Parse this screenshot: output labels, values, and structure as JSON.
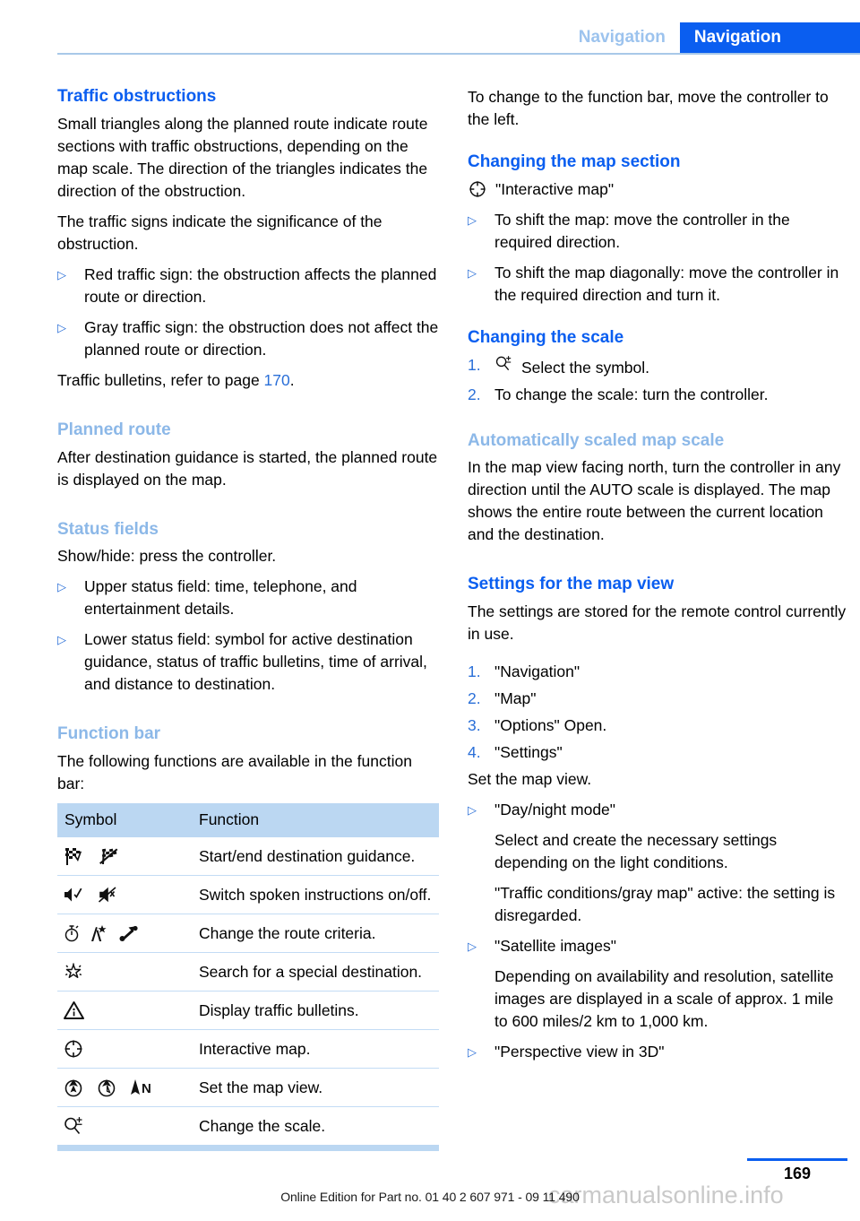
{
  "header": {
    "tab_inactive": "Navigation",
    "tab_active": "Navigation",
    "accent_blue": "#0a5ef0",
    "light_blue": "#8cb8e8"
  },
  "left_column": {
    "s1": {
      "heading": "Traffic obstructions",
      "p1": "Small triangles along the planned route indicate route sections with traffic obstructions, depending on the map scale. The direction of the triangles indicates the direction of the obstruction.",
      "p2": "The traffic signs indicate the significance of the obstruction.",
      "b1": "Red traffic sign: the obstruction affects the planned route or direction.",
      "b2": "Gray traffic sign: the obstruction does not affect the planned route or direction.",
      "p3_pre": "Traffic bulletins, refer to page ",
      "p3_link": "170",
      "p3_post": "."
    },
    "s2": {
      "heading": "Planned route",
      "p1": "After destination guidance is started, the planned route is displayed on the map."
    },
    "s3": {
      "heading": "Status fields",
      "p1": "Show/hide: press the controller.",
      "b1": "Upper status field: time, telephone, and entertainment details.",
      "b2": "Lower status field: symbol for active destination guidance, status of traffic bulletins, time of arrival, and distance to destination."
    },
    "s4": {
      "heading": "Function bar",
      "p1": "The following functions are available in the function bar:"
    },
    "table": {
      "headers": [
        "Symbol",
        "Function"
      ],
      "rows": [
        {
          "icons": [
            "checkered-flag-icon",
            "checkered-flag-crossed-icon"
          ],
          "function": "Start/end destination guidance."
        },
        {
          "icons": [
            "speaker-check-icon",
            "speaker-mute-icon"
          ],
          "function": "Switch spoken instructions on/off."
        },
        {
          "icons": [
            "stopwatch-icon",
            "road-star-icon",
            "route-arrow-icon"
          ],
          "function": "Change the route criteria."
        },
        {
          "icons": [
            "star-burst-icon"
          ],
          "function": "Search for a special destination."
        },
        {
          "icons": [
            "warning-triangle-info-icon"
          ],
          "function": "Display traffic bulletins."
        },
        {
          "icons": [
            "interactive-map-icon"
          ],
          "function": "Interactive map."
        },
        {
          "icons": [
            "map-view-circle-icon",
            "map-view-circle-outline-icon",
            "north-arrow-icon"
          ],
          "function": "Set the map view."
        },
        {
          "icons": [
            "magnifier-plusminus-icon"
          ],
          "function": "Change the scale."
        }
      ]
    }
  },
  "right_column": {
    "intro": "To change to the function bar, move the controller to the left.",
    "s1": {
      "heading": "Changing the map section",
      "sym_label": "\"Interactive map\"",
      "b1": "To shift the map: move the controller in the required direction.",
      "b2": "To shift the map diagonally: move the controller in the required direction and turn it."
    },
    "s2": {
      "heading": "Changing the scale",
      "n1_num": "1.",
      "n1": "Select the symbol.",
      "n2_num": "2.",
      "n2": "To change the scale: turn the controller."
    },
    "s3": {
      "heading": "Automatically scaled map scale",
      "p1": "In the map view facing north, turn the controller in any direction until the AUTO scale is displayed. The map shows the entire route between the current location and the destination."
    },
    "s4": {
      "heading": "Settings for the map view",
      "p1": "The settings are stored for the remote control currently in use.",
      "n1_num": "1.",
      "n1": "\"Navigation\"",
      "n2_num": "2.",
      "n2": "\"Map\"",
      "n3_num": "3.",
      "n3": "\"Options\" Open.",
      "n4_num": "4.",
      "n4": "\"Settings\"",
      "p2": "Set the map view.",
      "b1": "\"Day/night mode\"",
      "b1_p1": "Select and create the necessary settings depending on the light conditions.",
      "b1_p2": "\"Traffic conditions/gray map\" active: the setting is disregarded.",
      "b2": "\"Satellite images\"",
      "b2_p1": "Depending on availability and resolution, satellite images are displayed in a scale of approx. 1 mile to 600 miles/2 km to 1,000 km.",
      "b3": "\"Perspective view in 3D\""
    }
  },
  "footer": {
    "edition_note": "Online Edition for Part no. 01 40 2 607 971 - 09 11 490",
    "watermark": "carmanualsonline.info",
    "page_number": "169"
  },
  "bullet_marker": "▷"
}
